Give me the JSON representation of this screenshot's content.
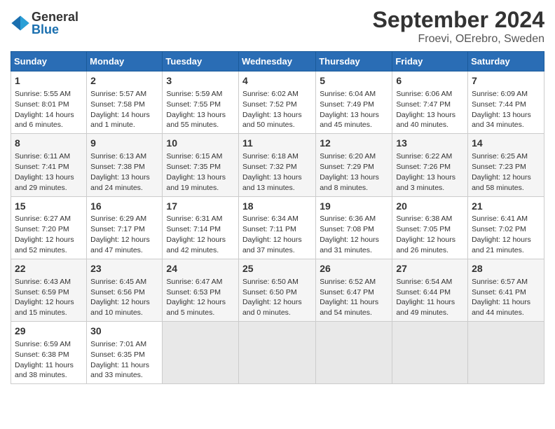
{
  "header": {
    "logo": {
      "general": "General",
      "blue": "Blue"
    },
    "title": "September 2024",
    "subtitle": "Froevi, OErebro, Sweden"
  },
  "columns": [
    "Sunday",
    "Monday",
    "Tuesday",
    "Wednesday",
    "Thursday",
    "Friday",
    "Saturday"
  ],
  "weeks": [
    [
      {
        "day": "1",
        "sunrise": "5:55 AM",
        "sunset": "8:01 PM",
        "daylight": "14 hours and 6 minutes."
      },
      {
        "day": "2",
        "sunrise": "5:57 AM",
        "sunset": "7:58 PM",
        "daylight": "14 hours and 1 minute."
      },
      {
        "day": "3",
        "sunrise": "5:59 AM",
        "sunset": "7:55 PM",
        "daylight": "13 hours and 55 minutes."
      },
      {
        "day": "4",
        "sunrise": "6:02 AM",
        "sunset": "7:52 PM",
        "daylight": "13 hours and 50 minutes."
      },
      {
        "day": "5",
        "sunrise": "6:04 AM",
        "sunset": "7:49 PM",
        "daylight": "13 hours and 45 minutes."
      },
      {
        "day": "6",
        "sunrise": "6:06 AM",
        "sunset": "7:47 PM",
        "daylight": "13 hours and 40 minutes."
      },
      {
        "day": "7",
        "sunrise": "6:09 AM",
        "sunset": "7:44 PM",
        "daylight": "13 hours and 34 minutes."
      }
    ],
    [
      {
        "day": "8",
        "sunrise": "6:11 AM",
        "sunset": "7:41 PM",
        "daylight": "13 hours and 29 minutes."
      },
      {
        "day": "9",
        "sunrise": "6:13 AM",
        "sunset": "7:38 PM",
        "daylight": "13 hours and 24 minutes."
      },
      {
        "day": "10",
        "sunrise": "6:15 AM",
        "sunset": "7:35 PM",
        "daylight": "13 hours and 19 minutes."
      },
      {
        "day": "11",
        "sunrise": "6:18 AM",
        "sunset": "7:32 PM",
        "daylight": "13 hours and 13 minutes."
      },
      {
        "day": "12",
        "sunrise": "6:20 AM",
        "sunset": "7:29 PM",
        "daylight": "13 hours and 8 minutes."
      },
      {
        "day": "13",
        "sunrise": "6:22 AM",
        "sunset": "7:26 PM",
        "daylight": "13 hours and 3 minutes."
      },
      {
        "day": "14",
        "sunrise": "6:25 AM",
        "sunset": "7:23 PM",
        "daylight": "12 hours and 58 minutes."
      }
    ],
    [
      {
        "day": "15",
        "sunrise": "6:27 AM",
        "sunset": "7:20 PM",
        "daylight": "12 hours and 52 minutes."
      },
      {
        "day": "16",
        "sunrise": "6:29 AM",
        "sunset": "7:17 PM",
        "daylight": "12 hours and 47 minutes."
      },
      {
        "day": "17",
        "sunrise": "6:31 AM",
        "sunset": "7:14 PM",
        "daylight": "12 hours and 42 minutes."
      },
      {
        "day": "18",
        "sunrise": "6:34 AM",
        "sunset": "7:11 PM",
        "daylight": "12 hours and 37 minutes."
      },
      {
        "day": "19",
        "sunrise": "6:36 AM",
        "sunset": "7:08 PM",
        "daylight": "12 hours and 31 minutes."
      },
      {
        "day": "20",
        "sunrise": "6:38 AM",
        "sunset": "7:05 PM",
        "daylight": "12 hours and 26 minutes."
      },
      {
        "day": "21",
        "sunrise": "6:41 AM",
        "sunset": "7:02 PM",
        "daylight": "12 hours and 21 minutes."
      }
    ],
    [
      {
        "day": "22",
        "sunrise": "6:43 AM",
        "sunset": "6:59 PM",
        "daylight": "12 hours and 15 minutes."
      },
      {
        "day": "23",
        "sunrise": "6:45 AM",
        "sunset": "6:56 PM",
        "daylight": "12 hours and 10 minutes."
      },
      {
        "day": "24",
        "sunrise": "6:47 AM",
        "sunset": "6:53 PM",
        "daylight": "12 hours and 5 minutes."
      },
      {
        "day": "25",
        "sunrise": "6:50 AM",
        "sunset": "6:50 PM",
        "daylight": "12 hours and 0 minutes."
      },
      {
        "day": "26",
        "sunrise": "6:52 AM",
        "sunset": "6:47 PM",
        "daylight": "11 hours and 54 minutes."
      },
      {
        "day": "27",
        "sunrise": "6:54 AM",
        "sunset": "6:44 PM",
        "daylight": "11 hours and 49 minutes."
      },
      {
        "day": "28",
        "sunrise": "6:57 AM",
        "sunset": "6:41 PM",
        "daylight": "11 hours and 44 minutes."
      }
    ],
    [
      {
        "day": "29",
        "sunrise": "6:59 AM",
        "sunset": "6:38 PM",
        "daylight": "11 hours and 38 minutes."
      },
      {
        "day": "30",
        "sunrise": "7:01 AM",
        "sunset": "6:35 PM",
        "daylight": "11 hours and 33 minutes."
      },
      null,
      null,
      null,
      null,
      null
    ]
  ]
}
